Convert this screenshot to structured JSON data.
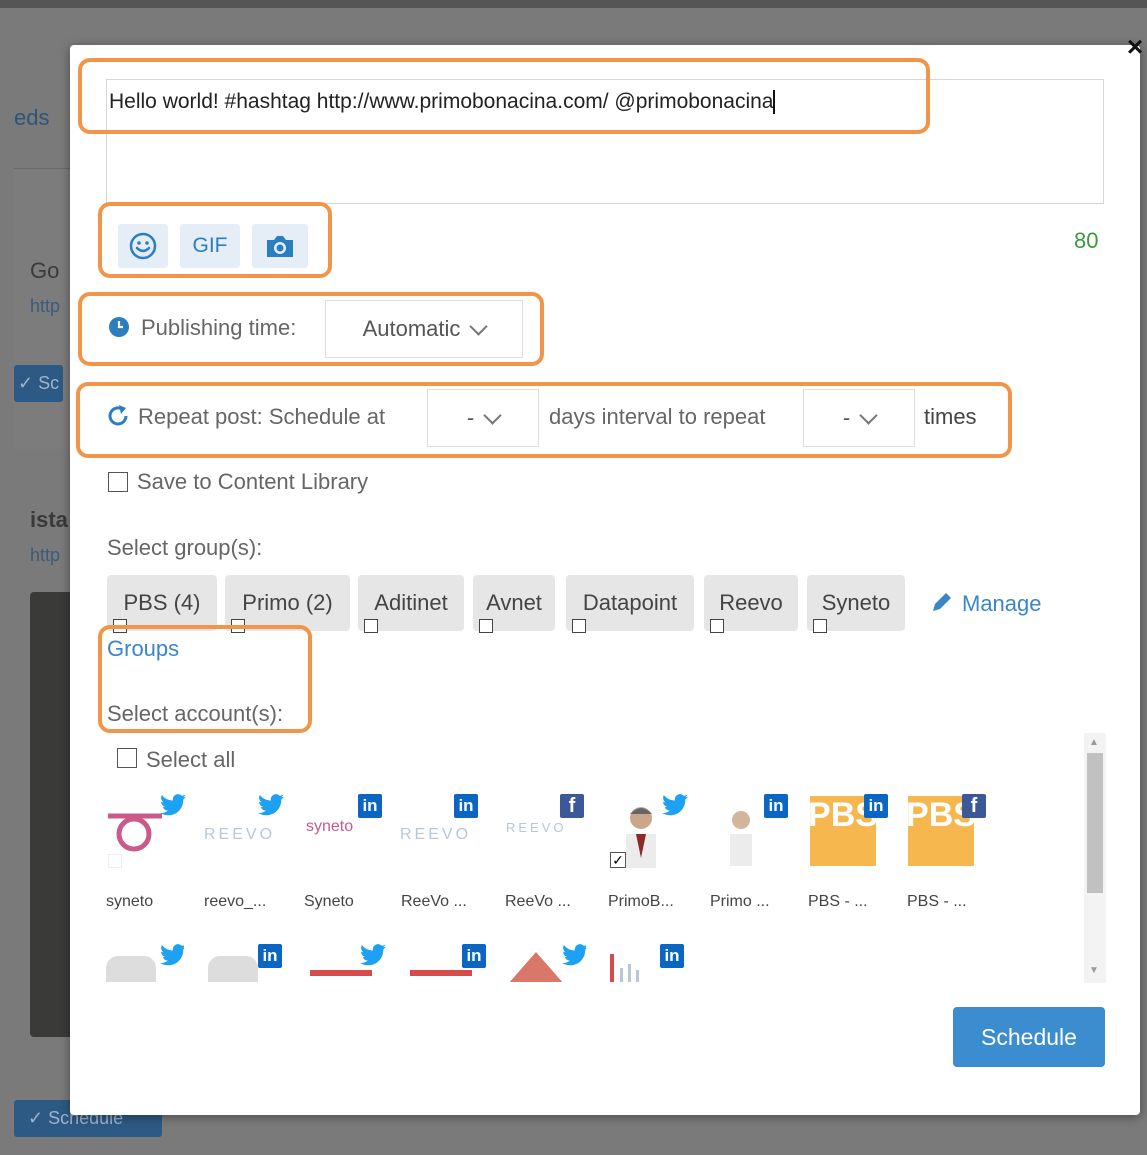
{
  "background": {
    "nav_fragment": "eds",
    "card1_title_fragment": "Go",
    "card1_link_fragment": "http",
    "card2_title_fragment": "ista",
    "card2_link_fragment": "http",
    "btn_fragment": "Sc",
    "bottom_button": "Schedule"
  },
  "composer": {
    "text": "Hello world! #hashtag http://www.primobonacina.com/ @primobonacina",
    "char_count": "80"
  },
  "toolbar": {
    "emoji_icon": "smile-icon",
    "gif_label": "GIF",
    "photo_icon": "camera-icon"
  },
  "publishing": {
    "label": "Publishing time:",
    "value": "Automatic"
  },
  "repeat": {
    "label": "Repeat post: Schedule at",
    "interval_value": "-",
    "middle_label": "days interval to repeat",
    "times_value": "-",
    "end_label": "times"
  },
  "save_library_label": "Save to Content Library",
  "groups": {
    "label": "Select group(s):",
    "items": [
      {
        "label": "PBS (4)"
      },
      {
        "label": "Primo (2)"
      },
      {
        "label": "Aditinet"
      },
      {
        "label": "Avnet"
      },
      {
        "label": "Datapoint"
      },
      {
        "label": "Reevo"
      },
      {
        "label": "Syneto"
      }
    ],
    "manage_link": "Manage",
    "manage_link_2": "Groups"
  },
  "accounts": {
    "label": "Select account(s):",
    "select_all": "Select all",
    "row1": [
      {
        "name": "syneto",
        "network": "twitter",
        "logo": "syneto-logo"
      },
      {
        "name": "reevo_...",
        "network": "twitter",
        "logo": "reevo-logo"
      },
      {
        "name": "Syneto",
        "network": "linkedin",
        "logo": "syneto-wordmark"
      },
      {
        "name": "ReeVo ...",
        "network": "linkedin",
        "logo": "reevo-logo"
      },
      {
        "name": "ReeVo ...",
        "network": "facebook",
        "logo": "reevo-logo"
      },
      {
        "name": "PrimoB...",
        "network": "twitter",
        "logo": "profile-photo",
        "checked": true
      },
      {
        "name": "Primo ...",
        "network": "linkedin",
        "logo": "profile-photo"
      },
      {
        "name": "PBS - ...",
        "network": "linkedin",
        "logo": "pbs-logo"
      },
      {
        "name": "PBS - ...",
        "network": "facebook",
        "logo": "pbs-logo"
      }
    ],
    "row2_networks": [
      "twitter",
      "linkedin",
      "twitter",
      "linkedin",
      "twitter",
      "linkedin"
    ]
  },
  "schedule_button": "Schedule",
  "colors": {
    "accent": "#3c8dd0",
    "highlight": "#f0954a",
    "twitter": "#1da1f2",
    "linkedin": "#0a66c2",
    "facebook": "#3b5998",
    "count_ok": "#3c9a3c"
  }
}
